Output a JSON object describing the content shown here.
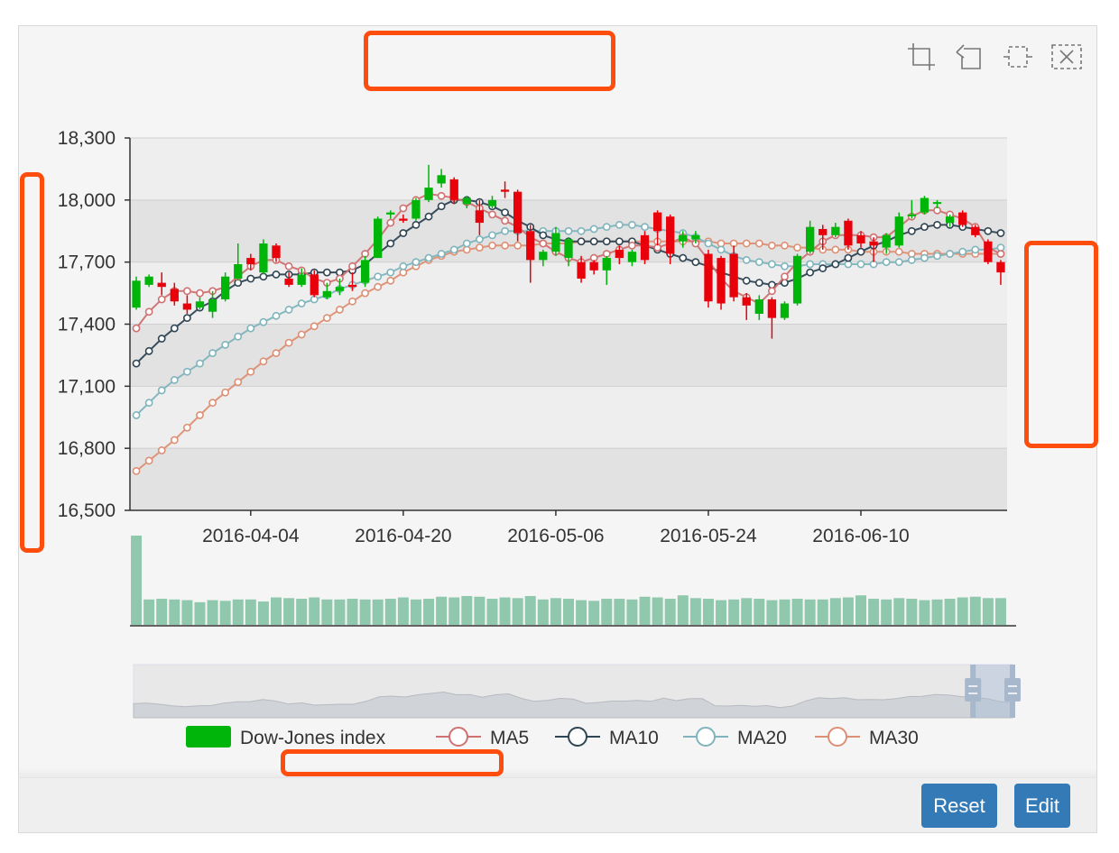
{
  "toolbar": {
    "icons": [
      "zoom-area-icon",
      "zoom-back-icon",
      "brush-rect-icon",
      "brush-clear-icon"
    ]
  },
  "buttons": {
    "reset_label": "Reset",
    "edit_label": "Edit"
  },
  "colors": {
    "up": "#00b50a",
    "down": "#e8000b",
    "volume": "#8fc8ac",
    "ma5": "#d07070",
    "ma10": "#2f4554",
    "ma20": "#7fb4bd",
    "ma30": "#dd8f74",
    "annotation": "#ff4d0d",
    "button": "#337ab7"
  },
  "chart_data": {
    "type": "candlestick",
    "title": "",
    "y_axis": {
      "min": 16500,
      "max": 18300,
      "interval": 300,
      "tick_labels": [
        "18,300",
        "18,000",
        "17,700",
        "17,400",
        "17,100",
        "16,800",
        "16,500"
      ]
    },
    "x_axis": {
      "tick_labels": [
        "2016-04-04",
        "2016-04-20",
        "2016-05-06",
        "2016-05-24",
        "2016-06-10"
      ],
      "tick_indices": [
        9,
        21,
        33,
        45,
        57
      ]
    },
    "grid": "alternating bands",
    "legend": {
      "position": "bottom",
      "items": [
        {
          "name": "Dow-Jones index",
          "symbol": "rect",
          "color": "#00b50a"
        },
        {
          "name": "MA5",
          "symbol": "circle",
          "color": "#d07070"
        },
        {
          "name": "MA10",
          "symbol": "circle",
          "color": "#2f4554"
        },
        {
          "name": "MA20",
          "symbol": "circle",
          "color": "#7fb4bd"
        },
        {
          "name": "MA30",
          "symbol": "circle",
          "color": "#dd8f74"
        }
      ]
    },
    "candles": [
      [
        17480,
        17610,
        17470,
        17630
      ],
      [
        17590,
        17630,
        17580,
        17640
      ],
      [
        17600,
        17580,
        17540,
        17650
      ],
      [
        17570,
        17510,
        17490,
        17600
      ],
      [
        17500,
        17470,
        17450,
        17540
      ],
      [
        17480,
        17510,
        17470,
        17530
      ],
      [
        17460,
        17520,
        17430,
        17560
      ],
      [
        17520,
        17630,
        17510,
        17650
      ],
      [
        17620,
        17690,
        17610,
        17790
      ],
      [
        17720,
        17690,
        17660,
        17740
      ],
      [
        17650,
        17790,
        17640,
        17810
      ],
      [
        17780,
        17720,
        17700,
        17790
      ],
      [
        17620,
        17590,
        17580,
        17650
      ],
      [
        17590,
        17640,
        17580,
        17670
      ],
      [
        17640,
        17540,
        17530,
        17660
      ],
      [
        17530,
        17560,
        17520,
        17600
      ],
      [
        17560,
        17580,
        17540,
        17620
      ],
      [
        17590,
        17580,
        17560,
        17650
      ],
      [
        17600,
        17710,
        17580,
        17730
      ],
      [
        17720,
        17910,
        17720,
        17920
      ],
      [
        17930,
        17940,
        17910,
        17950
      ],
      [
        17910,
        17900,
        17890,
        17930
      ],
      [
        17910,
        18000,
        17900,
        18010
      ],
      [
        18000,
        18060,
        17990,
        18170
      ],
      [
        18080,
        18120,
        18060,
        18150
      ],
      [
        18100,
        18000,
        17980,
        18110
      ],
      [
        17980,
        18010,
        17960,
        18020
      ],
      [
        17950,
        17890,
        17830,
        18000
      ],
      [
        17970,
        18000,
        17960,
        18020
      ],
      [
        18050,
        18040,
        18010,
        18090
      ],
      [
        18040,
        17840,
        17800,
        18050
      ],
      [
        17850,
        17710,
        17600,
        17880
      ],
      [
        17710,
        17750,
        17680,
        17760
      ],
      [
        17750,
        17840,
        17730,
        17870
      ],
      [
        17720,
        17810,
        17680,
        17820
      ],
      [
        17700,
        17620,
        17600,
        17730
      ],
      [
        17700,
        17660,
        17640,
        17710
      ],
      [
        17660,
        17720,
        17590,
        17730
      ],
      [
        17760,
        17720,
        17690,
        17780
      ],
      [
        17700,
        17750,
        17680,
        17760
      ],
      [
        17830,
        17710,
        17690,
        17850
      ],
      [
        17940,
        17850,
        17780,
        17950
      ],
      [
        17920,
        17740,
        17690,
        17930
      ],
      [
        17800,
        17830,
        17770,
        17850
      ],
      [
        17810,
        17830,
        17790,
        17850
      ],
      [
        17740,
        17510,
        17480,
        17760
      ],
      [
        17720,
        17500,
        17470,
        17730
      ],
      [
        17740,
        17530,
        17510,
        17780
      ],
      [
        17530,
        17490,
        17420,
        17550
      ],
      [
        17450,
        17520,
        17420,
        17540
      ],
      [
        17520,
        17430,
        17330,
        17530
      ],
      [
        17430,
        17500,
        17420,
        17510
      ],
      [
        17500,
        17730,
        17490,
        17740
      ],
      [
        17750,
        17870,
        17740,
        17900
      ],
      [
        17860,
        17830,
        17760,
        17880
      ],
      [
        17830,
        17870,
        17820,
        17890
      ],
      [
        17900,
        17780,
        17760,
        17910
      ],
      [
        17830,
        17790,
        17770,
        17850
      ],
      [
        17800,
        17780,
        17700,
        17820
      ],
      [
        17770,
        17830,
        17740,
        17840
      ],
      [
        17780,
        17920,
        17770,
        17940
      ],
      [
        17930,
        17930,
        17910,
        18000
      ],
      [
        17940,
        18010,
        17930,
        18020
      ],
      [
        17990,
        17990,
        17960,
        18000
      ],
      [
        17890,
        17920,
        17870,
        17930
      ],
      [
        17940,
        17880,
        17870,
        17950
      ],
      [
        17870,
        17830,
        17820,
        17880
      ],
      [
        17800,
        17700,
        17690,
        17810
      ],
      [
        17700,
        17650,
        17590,
        17710
      ]
    ],
    "ma5": [
      17380,
      17460,
      17520,
      17560,
      17560,
      17550,
      17560,
      17580,
      17630,
      17680,
      17710,
      17710,
      17680,
      17660,
      17620,
      17600,
      17620,
      17680,
      17740,
      17810,
      17890,
      17960,
      18000,
      18030,
      18020,
      18010,
      17990,
      17960,
      17930,
      17900,
      17870,
      17820,
      17790,
      17750,
      17720,
      17700,
      17720,
      17740,
      17760,
      17780,
      17780,
      17770,
      17790,
      17820,
      17790,
      17710,
      17620,
      17560,
      17530,
      17500,
      17560,
      17630,
      17700,
      17750,
      17800,
      17830,
      17830,
      17830,
      17820,
      17820,
      17870,
      17920,
      17950,
      17950,
      17930,
      17910,
      17870,
      17770,
      17740
    ],
    "ma10": [
      17210,
      17270,
      17330,
      17380,
      17430,
      17480,
      17510,
      17560,
      17600,
      17620,
      17630,
      17640,
      17640,
      17640,
      17650,
      17650,
      17650,
      17660,
      17690,
      17740,
      17790,
      17840,
      17880,
      17920,
      17970,
      18000,
      18000,
      17990,
      17970,
      17940,
      17900,
      17870,
      17830,
      17810,
      17800,
      17800,
      17800,
      17800,
      17800,
      17800,
      17780,
      17760,
      17740,
      17720,
      17700,
      17680,
      17650,
      17630,
      17610,
      17600,
      17590,
      17600,
      17620,
      17650,
      17670,
      17690,
      17720,
      17750,
      17780,
      17800,
      17830,
      17850,
      17870,
      17880,
      17880,
      17870,
      17860,
      17850,
      17840
    ],
    "ma20": [
      16960,
      17020,
      17080,
      17130,
      17170,
      17210,
      17260,
      17300,
      17340,
      17380,
      17410,
      17440,
      17470,
      17500,
      17520,
      17540,
      17570,
      17590,
      17610,
      17630,
      17650,
      17680,
      17700,
      17720,
      17740,
      17760,
      17790,
      17810,
      17830,
      17850,
      17850,
      17850,
      17850,
      17850,
      17850,
      17850,
      17860,
      17870,
      17880,
      17880,
      17870,
      17860,
      17850,
      17840,
      17820,
      17790,
      17760,
      17730,
      17710,
      17700,
      17690,
      17680,
      17680,
      17690,
      17690,
      17690,
      17690,
      17690,
      17690,
      17700,
      17700,
      17710,
      17720,
      17730,
      17740,
      17750,
      17760,
      17760,
      17770
    ],
    "ma30": [
      16690,
      16740,
      16790,
      16840,
      16900,
      16960,
      17020,
      17070,
      17120,
      17170,
      17220,
      17260,
      17310,
      17350,
      17390,
      17430,
      17470,
      17510,
      17550,
      17580,
      17610,
      17650,
      17680,
      17710,
      17730,
      17750,
      17760,
      17770,
      17780,
      17780,
      17780,
      17780,
      17790,
      17790,
      17790,
      17800,
      17800,
      17800,
      17800,
      17800,
      17800,
      17800,
      17800,
      17800,
      17800,
      17800,
      17790,
      17790,
      17790,
      17790,
      17780,
      17780,
      17770,
      17770,
      17760,
      17760,
      17760,
      17750,
      17750,
      17750,
      17750,
      17740,
      17740,
      17740,
      17740,
      17740,
      17740,
      17740,
      17740
    ],
    "volume": [
      130,
      37,
      38,
      37,
      36,
      33,
      36,
      35,
      37,
      37,
      34,
      40,
      39,
      38,
      40,
      37,
      37,
      38,
      37,
      37,
      38,
      40,
      37,
      38,
      41,
      40,
      42,
      41,
      38,
      40,
      39,
      42,
      37,
      39,
      38,
      36,
      35,
      38,
      38,
      37,
      41,
      40,
      38,
      43,
      39,
      38,
      36,
      37,
      39,
      38,
      36,
      37,
      38,
      37,
      37,
      39,
      40,
      43,
      38,
      37,
      39,
      38,
      36,
      37,
      38,
      40,
      41,
      39,
      39
    ],
    "dataZoom": {
      "start_fraction": 0.955,
      "end_fraction": 1.0
    }
  }
}
